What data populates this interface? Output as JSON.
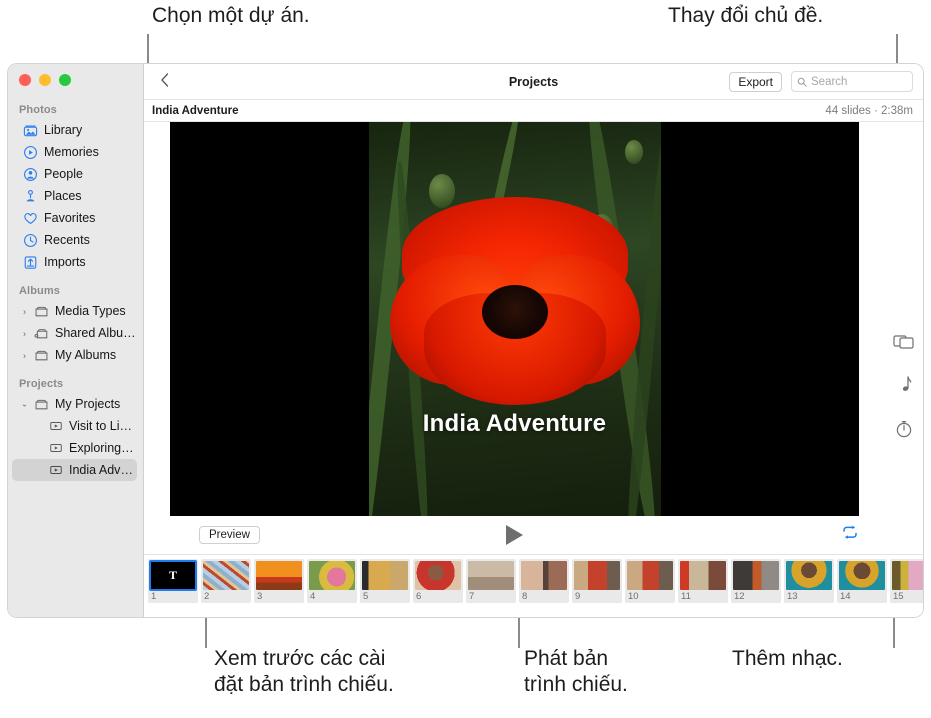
{
  "callouts": [
    {
      "id": "callout-project",
      "text": "Chọn một dự án."
    },
    {
      "id": "callout-theme",
      "text": "Thay đổi chủ đề."
    },
    {
      "id": "callout-preview",
      "text": "Xem trước các cài\nđặt bản trình chiếu."
    },
    {
      "id": "callout-play",
      "text": "Phát bản\ntrình chiếu."
    },
    {
      "id": "callout-music",
      "text": "Thêm nhạc."
    }
  ],
  "window": {
    "traffic_lights": {
      "close_color": "#ff5f57",
      "minimize_color": "#febc2e",
      "maximize_color": "#28c840"
    }
  },
  "sidebar": {
    "sections": [
      {
        "header": "Photos",
        "items": [
          {
            "label": "Library",
            "icon": "library-icon"
          },
          {
            "label": "Memories",
            "icon": "memories-icon"
          },
          {
            "label": "People",
            "icon": "people-icon"
          },
          {
            "label": "Places",
            "icon": "places-icon"
          },
          {
            "label": "Favorites",
            "icon": "heart-icon"
          },
          {
            "label": "Recents",
            "icon": "clock-icon"
          },
          {
            "label": "Imports",
            "icon": "import-icon"
          }
        ]
      },
      {
        "header": "Albums",
        "items": [
          {
            "label": "Media Types",
            "icon": "folder-icon",
            "disclosure": "collapsed"
          },
          {
            "label": "Shared Albums",
            "icon": "shared-folder-icon",
            "disclosure": "collapsed"
          },
          {
            "label": "My Albums",
            "icon": "folder-icon",
            "disclosure": "collapsed"
          }
        ]
      },
      {
        "header": "Projects",
        "items": [
          {
            "label": "My Projects",
            "icon": "folder-icon",
            "disclosure": "expanded"
          },
          {
            "label": "Visit to Lisbon",
            "icon": "slideshow-icon",
            "indent": 2
          },
          {
            "label": "Exploring Mor...",
            "icon": "slideshow-icon",
            "indent": 2
          },
          {
            "label": "India Adventure",
            "icon": "slideshow-icon",
            "indent": 2,
            "selected": true
          }
        ]
      }
    ]
  },
  "toolbar": {
    "back_icon": "chevron-left-icon",
    "title": "Projects",
    "export_label": "Export",
    "search_placeholder": "Search",
    "search_value": "",
    "search_icon": "search-icon"
  },
  "subbar": {
    "project_name": "India Adventure",
    "slide_meta": "44 slides · 2:38m"
  },
  "stage": {
    "slide_title": "India Adventure"
  },
  "controls": {
    "preview_label": "Preview",
    "play_icon": "play-icon",
    "loop_icon": "loop-icon",
    "loop_color": "#1e7bf0"
  },
  "rail": {
    "items": [
      {
        "icon": "theme-icon",
        "name": "theme-button"
      },
      {
        "icon": "music-note-icon",
        "name": "music-button"
      },
      {
        "icon": "duration-timer-icon",
        "name": "duration-button"
      }
    ]
  },
  "filmstrip": {
    "add_icon": "add-slide-icon",
    "thumbnails": [
      {
        "num": "1",
        "kind": "title",
        "title_glyph": "T",
        "selected": true
      },
      {
        "num": "2",
        "kind": "photo",
        "c1": "#9fb7cf",
        "c2": "#c04a2e",
        "c3": "#d9c79a"
      },
      {
        "num": "3",
        "kind": "photo",
        "c1": "#f2901f",
        "c2": "#d94a1e",
        "c3": "#8c3b16"
      },
      {
        "num": "4",
        "kind": "photo",
        "c1": "#e4789c",
        "c2": "#d8bb3f",
        "c3": "#7a9c4a"
      },
      {
        "num": "5",
        "kind": "photo",
        "c1": "#d8a94f",
        "c2": "#caa86b",
        "c3": "#3f4c6b"
      },
      {
        "num": "6",
        "kind": "photo",
        "c1": "#c8352c",
        "c2": "#8a5a42",
        "c3": "#e0c2a6"
      },
      {
        "num": "7",
        "kind": "photo",
        "c1": "#cbbba6",
        "c2": "#a08d7a",
        "c3": "#6b4a45"
      },
      {
        "num": "8",
        "kind": "photo",
        "c1": "#d8b49a",
        "c2": "#9b6b55",
        "c3": "#57413a"
      },
      {
        "num": "9",
        "kind": "photo",
        "c1": "#c4412c",
        "c2": "#c9a882",
        "c3": "#6e5d4e"
      },
      {
        "num": "10",
        "kind": "photo",
        "c1": "#c4412c",
        "c2": "#c9a882",
        "c3": "#6e5d4e"
      },
      {
        "num": "11",
        "kind": "photo",
        "c1": "#cf3a27",
        "c2": "#c9b79a",
        "c3": "#7a4a3b"
      },
      {
        "num": "12",
        "kind": "photo",
        "c1": "#3d3a38",
        "c2": "#c25a2a",
        "c3": "#8f8a85"
      },
      {
        "num": "13",
        "kind": "photo",
        "c1": "#d8a32a",
        "c2": "#1f8fa0",
        "c3": "#6b4a35"
      },
      {
        "num": "14",
        "kind": "photo",
        "c1": "#d8a32a",
        "c2": "#1f8fa0",
        "c3": "#6b4a35"
      },
      {
        "num": "15",
        "kind": "photo",
        "c1": "#cbb23f",
        "c2": "#e3a8c4",
        "c3": "#8a6a8f"
      }
    ]
  }
}
